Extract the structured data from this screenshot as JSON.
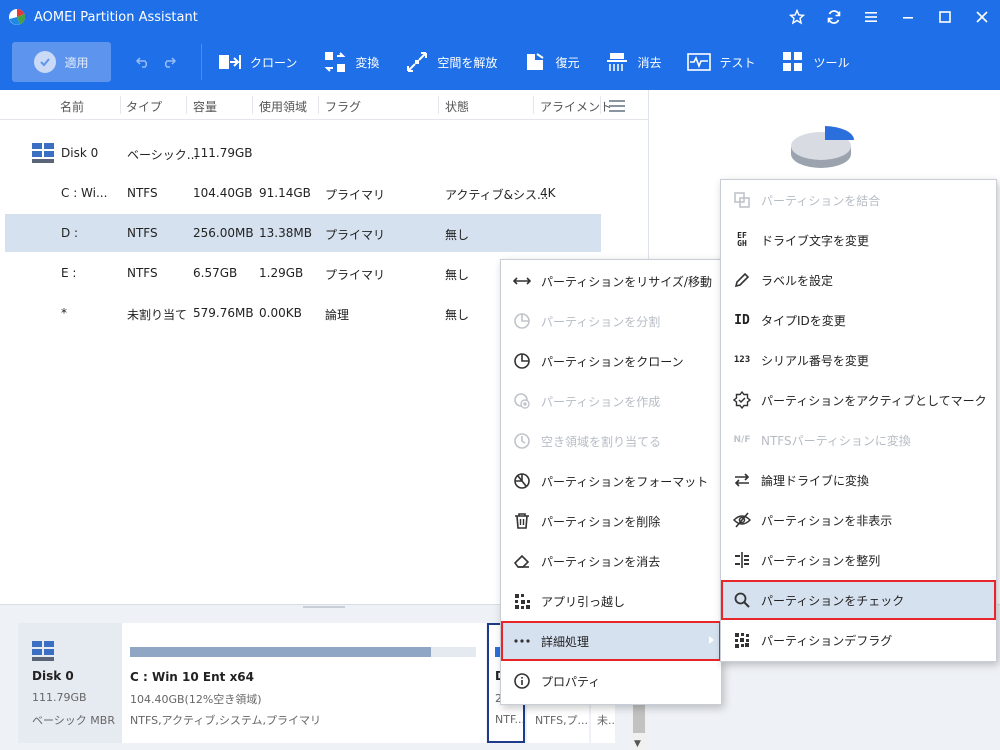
{
  "window": {
    "title": "AOMEI Partition Assistant"
  },
  "toolbar": {
    "apply_label": "適用",
    "tools": [
      "クローン",
      "変換",
      "空間を解放",
      "復元",
      "消去",
      "テスト",
      "ツール"
    ]
  },
  "columns": [
    "名前",
    "タイプ",
    "容量",
    "使用領域",
    "フラグ",
    "状態",
    "アライメント"
  ],
  "rows": [
    {
      "name": "Disk 0",
      "type": "ベーシック...",
      "capacity": "111.79GB",
      "used": "",
      "flag": "",
      "status": "",
      "align": ""
    },
    {
      "name": "C : Wi...",
      "type": "NTFS",
      "capacity": "104.40GB",
      "used": "91.14GB",
      "flag": "プライマリ",
      "status": "アクティブ&シス...",
      "align": "4K"
    },
    {
      "name": "D :",
      "type": "NTFS",
      "capacity": "256.00MB",
      "used": "13.38MB",
      "flag": "プライマリ",
      "status": "無し",
      "align": ""
    },
    {
      "name": "E :",
      "type": "NTFS",
      "capacity": "6.57GB",
      "used": "1.29GB",
      "flag": "プライマリ",
      "status": "無し",
      "align": ""
    },
    {
      "name": "*",
      "type": "未割り当て",
      "capacity": "579.76MB",
      "used": "0.00KB",
      "flag": "論理",
      "status": "無し",
      "align": ""
    }
  ],
  "diskmap": {
    "disk": {
      "name": "Disk 0",
      "size": "111.79GB",
      "type": "ベーシック MBR"
    },
    "c": {
      "name": "C : Win 10 Ent x64",
      "info": "104.40GB(12%空き領域)",
      "fs": "NTFS,アクティブ,システム,プライマリ",
      "used_fraction": 0.87
    },
    "d": {
      "name": "D",
      "info": "2",
      "fs": "NTF...",
      "used_fraction": 0.05
    },
    "e": {
      "fs": "NTFS,プ..."
    },
    "u": {
      "fs": "未..."
    }
  },
  "context_menu": [
    {
      "label": "パーティションをリサイズ/移動",
      "icon": "resize-arrows-icon",
      "disabled": false
    },
    {
      "label": "パーティションを分割",
      "icon": "split-pie-icon",
      "disabled": true
    },
    {
      "label": "パーティションをクローン",
      "icon": "clone-pie-icon",
      "disabled": false
    },
    {
      "label": "パーティションを作成",
      "icon": "create-plus-icon",
      "disabled": true
    },
    {
      "label": "空き領域を割り当てる",
      "icon": "allocate-clock-icon",
      "disabled": true
    },
    {
      "label": "パーティションをフォーマット",
      "icon": "format-icon",
      "disabled": false
    },
    {
      "label": "パーティションを削除",
      "icon": "trash-icon",
      "disabled": false
    },
    {
      "label": "パーティションを消去",
      "icon": "eraser-icon",
      "disabled": false
    },
    {
      "label": "アプリ引っ越し",
      "icon": "app-move-icon",
      "disabled": false
    },
    {
      "label": "詳細処理",
      "icon": "more-dots-icon",
      "disabled": false,
      "active": true
    },
    {
      "label": "プロパティ",
      "icon": "info-icon",
      "disabled": false
    }
  ],
  "submenu": [
    {
      "label": "パーティションを結合",
      "icon": "merge-icon",
      "glyph": "",
      "disabled": true
    },
    {
      "label": "ドライブ文字を変更",
      "icon": "drive-letter-icon",
      "glyph": "EF GH",
      "disabled": false
    },
    {
      "label": "ラベルを設定",
      "icon": "pencil-icon",
      "glyph": "",
      "disabled": false
    },
    {
      "label": "タイプIDを変更",
      "icon": "id-icon",
      "glyph": "ID",
      "disabled": false
    },
    {
      "label": "シリアル番号を変更",
      "icon": "serial-icon",
      "glyph": "123",
      "disabled": false
    },
    {
      "label": "パーティションをアクティブとしてマーク",
      "icon": "badge-check-icon",
      "glyph": "",
      "disabled": false
    },
    {
      "label": "NTFSパーティションに変換",
      "icon": "convert-nf-icon",
      "glyph": "N/F",
      "disabled": true
    },
    {
      "label": "論理ドライブに変換",
      "icon": "swap-arrows-icon",
      "glyph": "",
      "disabled": false
    },
    {
      "label": "パーティションを非表示",
      "icon": "eye-off-icon",
      "glyph": "",
      "disabled": false
    },
    {
      "label": "パーティションを整列",
      "icon": "align-icon",
      "glyph": "",
      "disabled": false
    },
    {
      "label": "パーティションをチェック",
      "icon": "search-icon",
      "glyph": "",
      "disabled": false,
      "active": true
    },
    {
      "label": "パーティションデフラグ",
      "icon": "defrag-icon",
      "glyph": "",
      "disabled": false
    }
  ],
  "colors": {
    "accent": "#1e6fe8",
    "selected_row": "#d6e1f0",
    "highlight_border": "#e8262a"
  }
}
